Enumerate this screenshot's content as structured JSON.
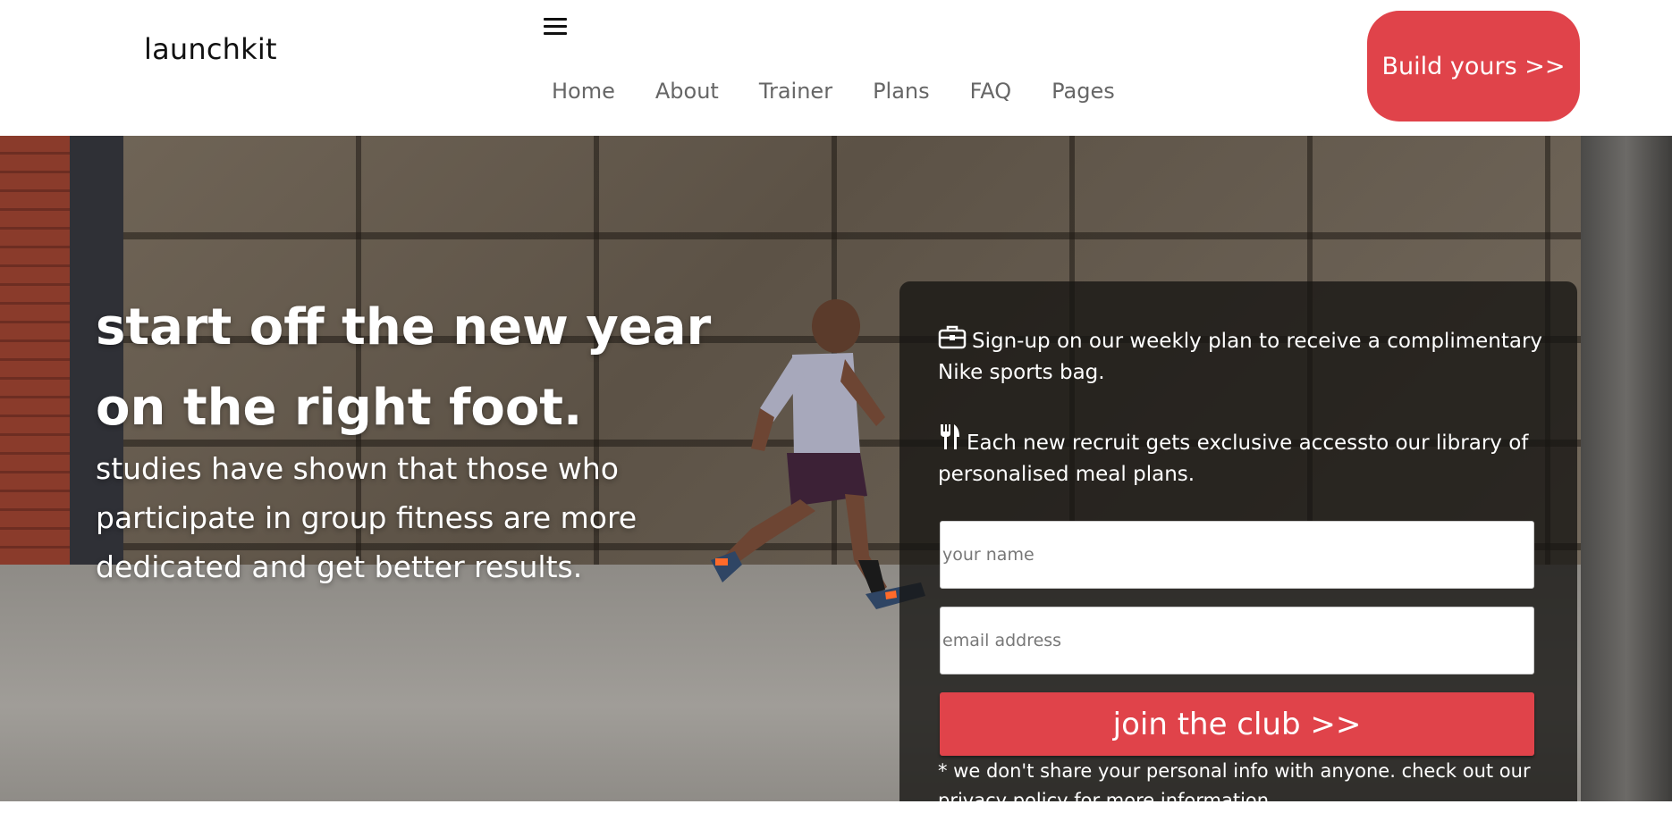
{
  "header": {
    "logo": "launchkit",
    "nav": [
      "Home",
      "About",
      "Trainer",
      "Plans",
      "FAQ",
      "Pages"
    ],
    "cta": "Build yours >>"
  },
  "hero": {
    "title": "start off the new year on the right foot.",
    "subtitle": "studies have shown that those who participate in group fitness are more dedicated and get better results."
  },
  "signup": {
    "perk1": "Sign-up on our weekly plan to receive a complimentary Nike sports bag.",
    "perk2": "Each new recruit gets exclusive accessto our library of personalised meal plans.",
    "name_placeholder": "your name",
    "email_placeholder": "email address",
    "submit": "join the club >>",
    "disclaimer": "* we don't share your personal info with anyone. check out our privacy policy for more information."
  },
  "colors": {
    "accent": "#e0434a",
    "panel": "#161412"
  },
  "icons": {
    "menu": "hamburger-menu-icon",
    "perk1": "briefcase-icon",
    "perk2": "utensils-icon"
  }
}
